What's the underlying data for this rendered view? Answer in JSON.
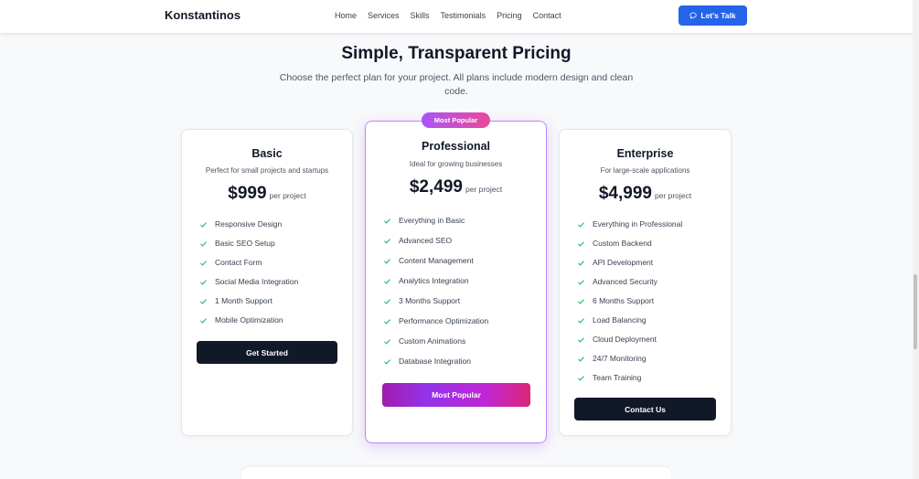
{
  "nav": {
    "brand": "Konstantinos",
    "links": [
      "Home",
      "Services",
      "Skills",
      "Testimonials",
      "Pricing",
      "Contact"
    ],
    "cta_label": "Let's Talk"
  },
  "section": {
    "title": "Simple, Transparent Pricing",
    "subtitle": "Choose the perfect plan for your project. All plans include modern design and clean code."
  },
  "plans": [
    {
      "name": "Basic",
      "description": "Perfect for small projects and startups",
      "price": "$999",
      "period": "per project",
      "features": [
        "Responsive Design",
        "Basic SEO Setup",
        "Contact Form",
        "Social Media Integration",
        "1 Month Support",
        "Mobile Optimization"
      ],
      "button_label": "Get Started"
    },
    {
      "name": "Professional",
      "badge": "Most Popular",
      "description": "Ideal for growing businesses",
      "price": "$2,499",
      "period": "per project",
      "features": [
        "Everything in Basic",
        "Advanced SEO",
        "Content Management",
        "Analytics Integration",
        "3 Months Support",
        "Performance Optimization",
        "Custom Animations",
        "Database Integration"
      ],
      "button_label": "Most Popular"
    },
    {
      "name": "Enterprise",
      "description": "For large-scale applications",
      "price": "$4,999",
      "period": "per project",
      "features": [
        "Everything in Professional",
        "Custom Backend",
        "API Development",
        "Advanced Security",
        "6 Months Support",
        "Load Balancing",
        "Cloud Deployment",
        "24/7 Monitoring",
        "Team Training"
      ],
      "button_label": "Contact Us"
    }
  ],
  "colors": {
    "accent_blue": "#2563eb",
    "check_green": "#22c55e",
    "gradient_start": "#a855f7",
    "gradient_end": "#ec4899",
    "dark_button": "#111827"
  },
  "icons": {
    "cta": "chat-bubble-icon",
    "feature": "check-icon"
  }
}
